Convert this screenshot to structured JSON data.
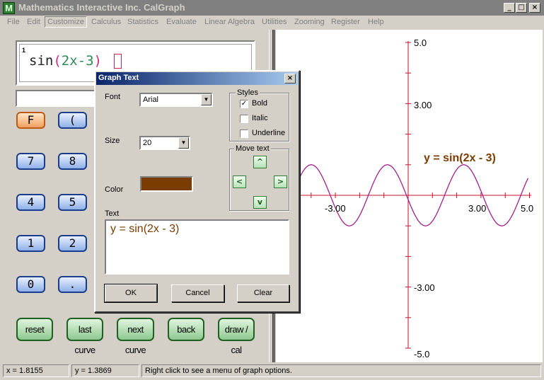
{
  "window": {
    "icon_letter": "M",
    "title": "Mathematics Interactive Inc. CalGraph",
    "minimize": "_",
    "maximize": "□",
    "close": "×"
  },
  "menu": [
    "File",
    "Edit",
    "Customize",
    "Calculus",
    "Statistics",
    "Evaluate",
    "Linear Algebra",
    "Utilities",
    "Zooming",
    "Register",
    "Help"
  ],
  "expression": {
    "line_number": "1",
    "func": "sin",
    "open": "(",
    "arg": "2x-3",
    "close": ")"
  },
  "keypad": {
    "f": "F",
    "lparen": "(",
    "seven": "7",
    "eight": "8",
    "four": "4",
    "five": "5",
    "one": "1",
    "two": "2",
    "zero": "0",
    "dot": "."
  },
  "commands": {
    "reset": "reset",
    "last_curve": "last curve",
    "next_curve": "next curve",
    "back": "back",
    "draw": "draw / cal"
  },
  "graph": {
    "x_range": [
      -5,
      5
    ],
    "y_range": [
      -5,
      5
    ],
    "tick_labels": {
      "x_neg": "-3.00",
      "x_pos": "3.00",
      "x_max": "5.0",
      "y_max": "5.0",
      "y_pos": "3.00",
      "y_neg": "-3.00",
      "y_min": "-5.0"
    },
    "curve_label": "y = sin(2x - 3)",
    "curve_color": "#a0208c",
    "axis_color": "#c8102e",
    "label_color": "#7a3c00"
  },
  "status": {
    "x": "x = 1.8155",
    "y": "y = 1.3869",
    "message": "Right click to see a menu of graph options."
  },
  "dialog": {
    "title": "Graph Text",
    "close": "×",
    "font_label": "Font",
    "font_value": "Arial",
    "size_label": "Size",
    "size_value": "20",
    "color_label": "Color",
    "color_value": "#7a3c00",
    "styles_title": "Styles",
    "bold": {
      "label": "Bold",
      "checked": true
    },
    "italic": {
      "label": "Italic",
      "checked": false
    },
    "underline": {
      "label": "Underline",
      "checked": false
    },
    "move_title": "Move text",
    "move_up": "^",
    "move_left": "<",
    "move_right": ">",
    "move_down": "v",
    "text_label": "Text",
    "text_value": "y = sin(2x - 3)",
    "ok": "OK",
    "cancel": "Cancel",
    "clear": "Clear"
  }
}
